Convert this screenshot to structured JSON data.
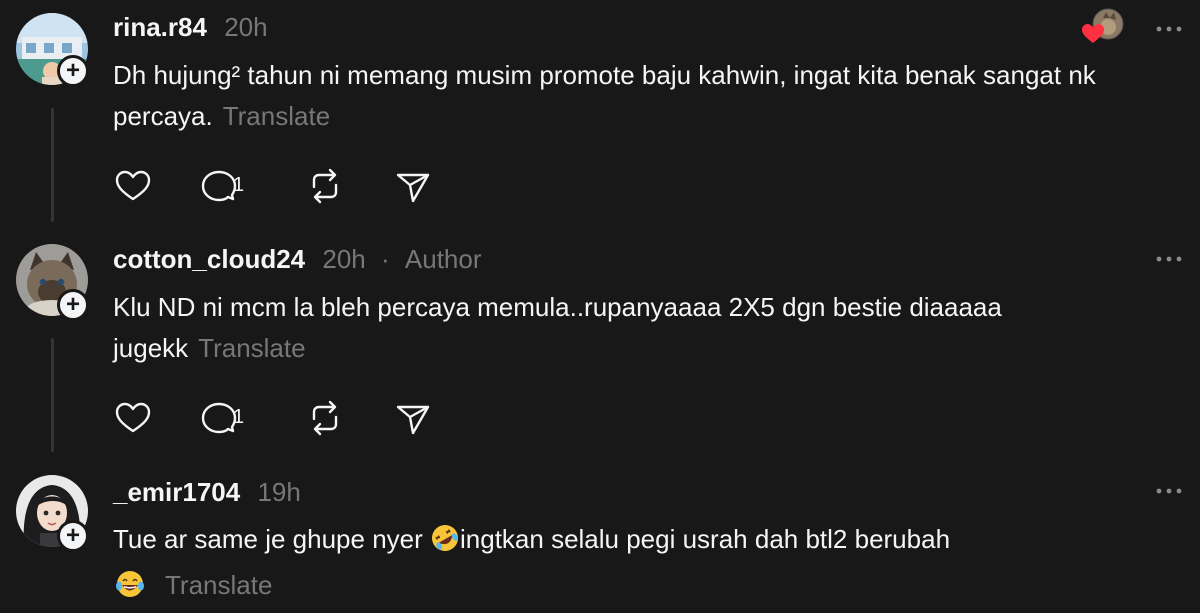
{
  "colors": {
    "background": "#181818",
    "text_primary": "#f3f5f7",
    "text_secondary": "#777777",
    "thread_line": "#333638",
    "heart_red": "#ff3040"
  },
  "posts": [
    {
      "username": "rina.r84",
      "time": "20h",
      "text": "Dh hujung² tahun ni memang musim promote baju kahwin, ingat kita benak sangat nk percaya.",
      "translate": "Translate",
      "reply_count": "1",
      "liked_by_author": true
    },
    {
      "username": "cotton_cloud24",
      "time": "20h",
      "separator": "·",
      "badge": "Author",
      "text": "Klu ND ni mcm la bleh percaya memula..rupanyaaaa 2X5 dgn bestie diaaaaa jugekk",
      "translate": "Translate",
      "reply_count": "1"
    },
    {
      "username": "_emir1704",
      "time": "19h",
      "text_before_emoji": "Tue ar same je ghupe nyer ",
      "emoji_1": "rolling-on-floor-laughing-emoji",
      "text_after_emoji": "ingtkan selalu pegi usrah dah btl2 berubah",
      "emoji_2": "tears-of-joy-emoji",
      "translate": "Translate"
    }
  ]
}
